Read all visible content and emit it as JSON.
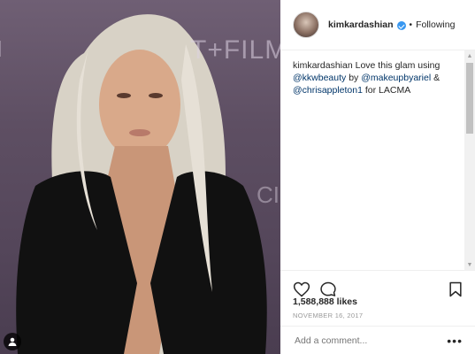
{
  "photo": {
    "backdrop_text_1": "T+FILM",
    "backdrop_text_2": "CI",
    "backdrop_text_3": "I"
  },
  "post": {
    "username": "kimkardashian",
    "separator": "•",
    "follow_status": "Following",
    "caption_user": "kimkardashian",
    "caption_text_1": "Love this glam using",
    "mention_1": "@kkwbeauty",
    "caption_by": "by",
    "mention_2": "@makeupbyariel",
    "caption_amp": "&",
    "mention_3": "@chrisappleton1",
    "caption_for": "for LACMA",
    "likes": "1,588,888 likes",
    "date": "NOVEMBER 16, 2017",
    "comment_placeholder": "Add a comment...",
    "more_label": "•••"
  },
  "scrollbar": {
    "up": "▲",
    "down": "▼"
  },
  "colors": {
    "verified": "#3897f0",
    "mention": "#003569"
  },
  "icons": [
    "heart-icon",
    "comment-icon",
    "bookmark-icon",
    "verified-icon",
    "tag-user-icon"
  ]
}
